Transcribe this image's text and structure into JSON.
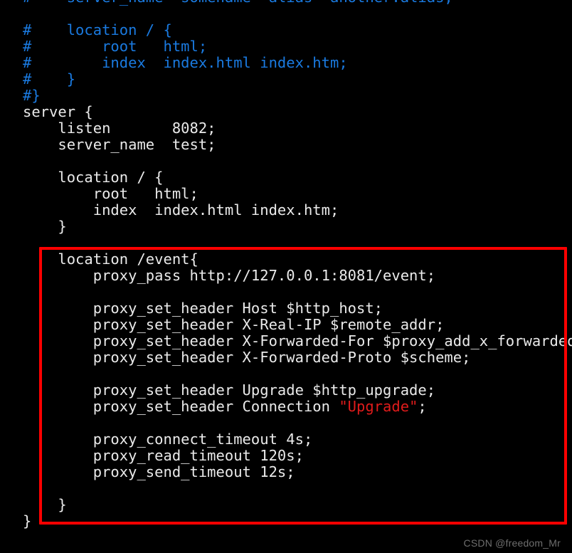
{
  "editor": {
    "background_color": "#000000",
    "text_color": "#eaeaea",
    "comment_color": "#1a7ae0",
    "string_color": "#e01b1b",
    "highlight_border_color": "#fe0000",
    "lines": [
      {
        "kind": "comment",
        "text": "#    server_name  somename  alias  another.alias;"
      },
      {
        "kind": "blank",
        "text": ""
      },
      {
        "kind": "comment",
        "text": "#    location / {"
      },
      {
        "kind": "comment",
        "text": "#        root   html;"
      },
      {
        "kind": "comment",
        "text": "#        index  index.html index.htm;"
      },
      {
        "kind": "comment",
        "text": "#    }"
      },
      {
        "kind": "comment",
        "text": "#}"
      },
      {
        "kind": "code",
        "text": "server {"
      },
      {
        "kind": "code",
        "text": "    listen       8082;"
      },
      {
        "kind": "code",
        "text": "    server_name  test;"
      },
      {
        "kind": "blank",
        "text": ""
      },
      {
        "kind": "code",
        "text": "    location / {"
      },
      {
        "kind": "code",
        "text": "        root   html;"
      },
      {
        "kind": "code",
        "text": "        index  index.html index.htm;"
      },
      {
        "kind": "code",
        "text": "    }"
      },
      {
        "kind": "blank",
        "text": ""
      },
      {
        "kind": "code",
        "text": "    location /event{"
      },
      {
        "kind": "code",
        "text": "        proxy_pass http://127.0.0.1:8081/event;"
      },
      {
        "kind": "blank",
        "text": ""
      },
      {
        "kind": "code",
        "text": "        proxy_set_header Host $http_host;"
      },
      {
        "kind": "code",
        "text": "        proxy_set_header X-Real-IP $remote_addr;"
      },
      {
        "kind": "code",
        "text": "        proxy_set_header X-Forwarded-For $proxy_add_x_forwarded_for;"
      },
      {
        "kind": "code",
        "text": "        proxy_set_header X-Forwarded-Proto $scheme;"
      },
      {
        "kind": "blank",
        "text": ""
      },
      {
        "kind": "code",
        "text": "        proxy_set_header Upgrade $http_upgrade;"
      },
      {
        "kind": "code-str",
        "text": "        proxy_set_header Connection ",
        "string": "\"Upgrade\"",
        "tail": ";"
      },
      {
        "kind": "blank",
        "text": ""
      },
      {
        "kind": "code",
        "text": "        proxy_connect_timeout 4s;"
      },
      {
        "kind": "code",
        "text": "        proxy_read_timeout 120s;"
      },
      {
        "kind": "code",
        "text": "        proxy_send_timeout 12s;"
      },
      {
        "kind": "blank",
        "text": ""
      },
      {
        "kind": "code",
        "text": "    }"
      },
      {
        "kind": "code",
        "text": "}"
      }
    ]
  },
  "highlight": {
    "label": "red-annotation-box"
  },
  "watermark": {
    "text": "CSDN @freedom_Mr"
  }
}
